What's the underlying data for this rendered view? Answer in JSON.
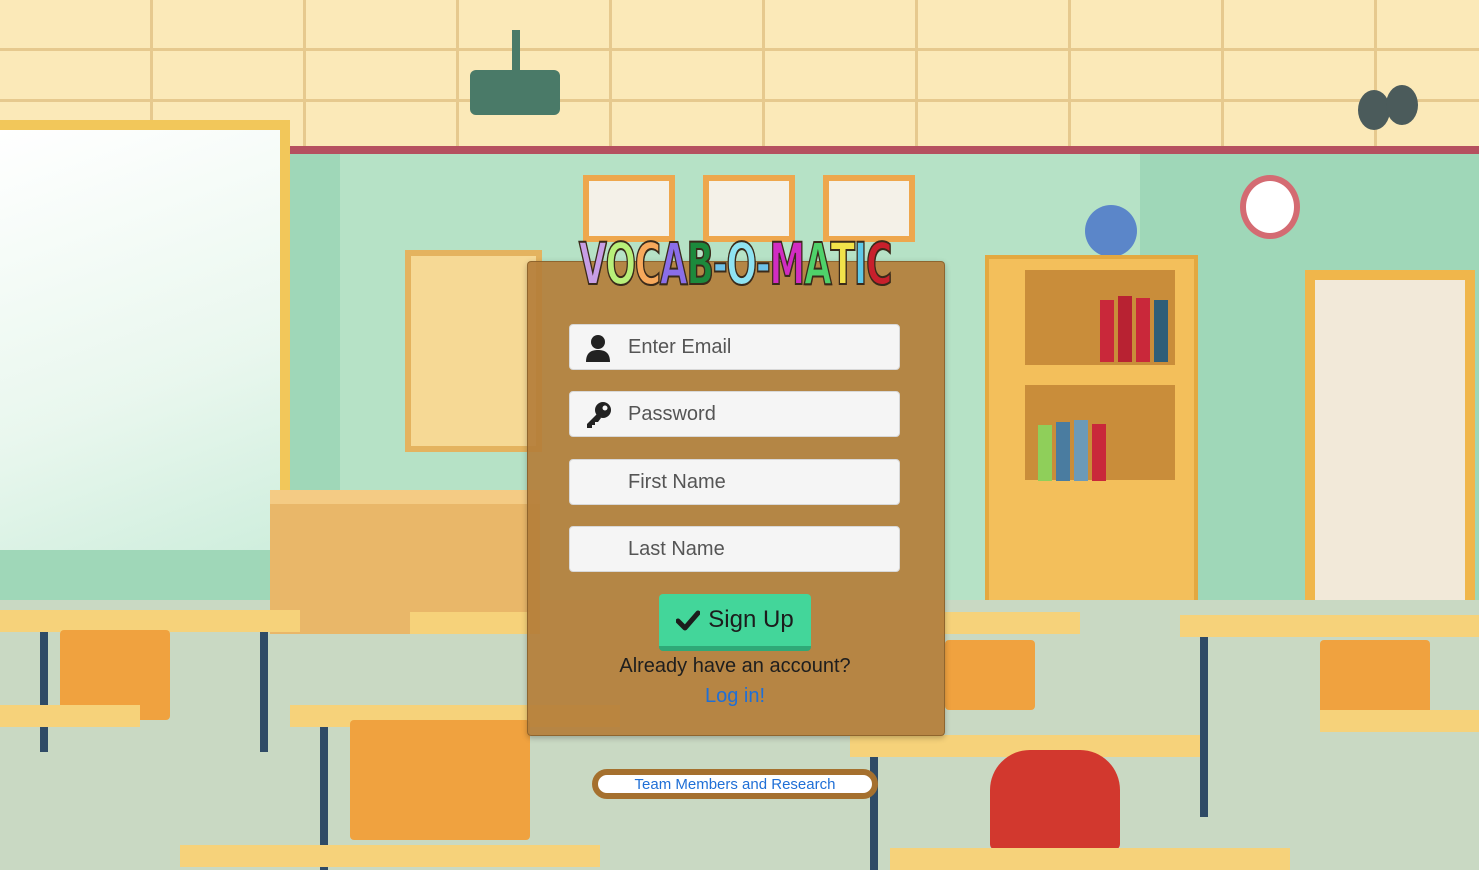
{
  "app": {
    "logo_letters": [
      {
        "char": "V",
        "color": "#c79ee6"
      },
      {
        "char": "O",
        "color": "#b8f07a"
      },
      {
        "char": "C",
        "color": "#f7a95c"
      },
      {
        "char": "A",
        "color": "#8a6ee8"
      },
      {
        "char": "B",
        "color": "#1c8a3c"
      },
      {
        "char": "-",
        "color": "#6ec3e8"
      },
      {
        "char": "O",
        "color": "#8fe3f2"
      },
      {
        "char": "-",
        "color": "#6ec3e8"
      },
      {
        "char": "M",
        "color": "#d12cc2"
      },
      {
        "char": "A",
        "color": "#4fd16a"
      },
      {
        "char": "T",
        "color": "#f2e24a"
      },
      {
        "char": "I",
        "color": "#5ec9e8"
      },
      {
        "char": "C",
        "color": "#c8202c"
      }
    ]
  },
  "form": {
    "email_placeholder": "Enter Email",
    "email_icon": "user-icon",
    "password_placeholder": "Password",
    "password_icon": "key-icon",
    "first_name_placeholder": "First Name",
    "last_name_placeholder": "Last Name",
    "signup_label": "Sign Up",
    "signup_icon": "check-icon"
  },
  "footer": {
    "already_text": "Already have an account?",
    "login_link": "Log in!",
    "team_link": "Team Members and Research"
  },
  "colors": {
    "card_bg": "#b47e3a",
    "signup_button": "#43d69a",
    "link": "#1f6fd6"
  }
}
